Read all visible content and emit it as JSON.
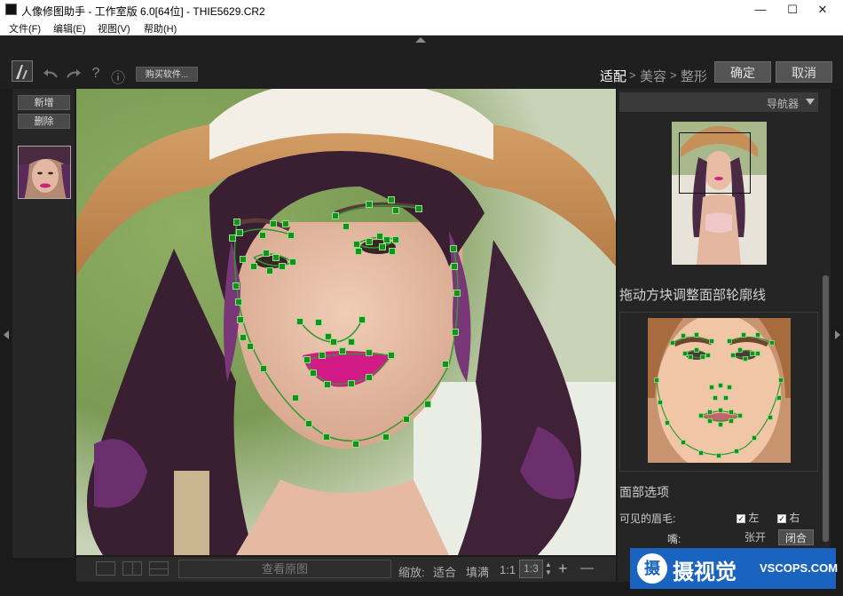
{
  "window": {
    "title": "人像修图助手 - 工作室版 6.0[64位] - THIE5629.CR2",
    "minimize": "—",
    "maximize": "☐",
    "close": "✕"
  },
  "menu": [
    "文件(F)",
    "编辑(E)",
    "视图(V)",
    "帮助(H)"
  ],
  "toolbar": {
    "help": "?",
    "info": "ⓘ",
    "buy_label": "购买软件...",
    "steps": [
      "适配",
      "美容",
      "整形"
    ],
    "step_sep": ">",
    "confirm_label": "确定",
    "cancel_label": "取消"
  },
  "left_panel": {
    "add_label": "新增",
    "delete_label": "删除"
  },
  "bottom_bar": {
    "view_original_label": "查看原图",
    "zoom_label": "缩放:",
    "fit_label": "适合",
    "fill_label": "填满",
    "one_to_one_label": "1:1",
    "zoom_value": "1:3",
    "zoom_in": "+",
    "zoom_out": "—"
  },
  "right_panel": {
    "navigator_label": "导航器",
    "instruction": "拖动方块调整面部轮廓线",
    "face_options_title": "面部选项",
    "eyebrows_label": "可见的眉毛:",
    "left_label": "左",
    "right_label": "右",
    "mouth_label": "嘴:",
    "open_label": "张开",
    "closed_label": "闭合"
  },
  "watermark": {
    "text": "摄视觉",
    "site": "VSCOPS.COM"
  },
  "colors": {
    "accent_green": "#1a8f1a",
    "marker_border": "#8fe08f",
    "watermark_blue": "#1a64c0"
  }
}
